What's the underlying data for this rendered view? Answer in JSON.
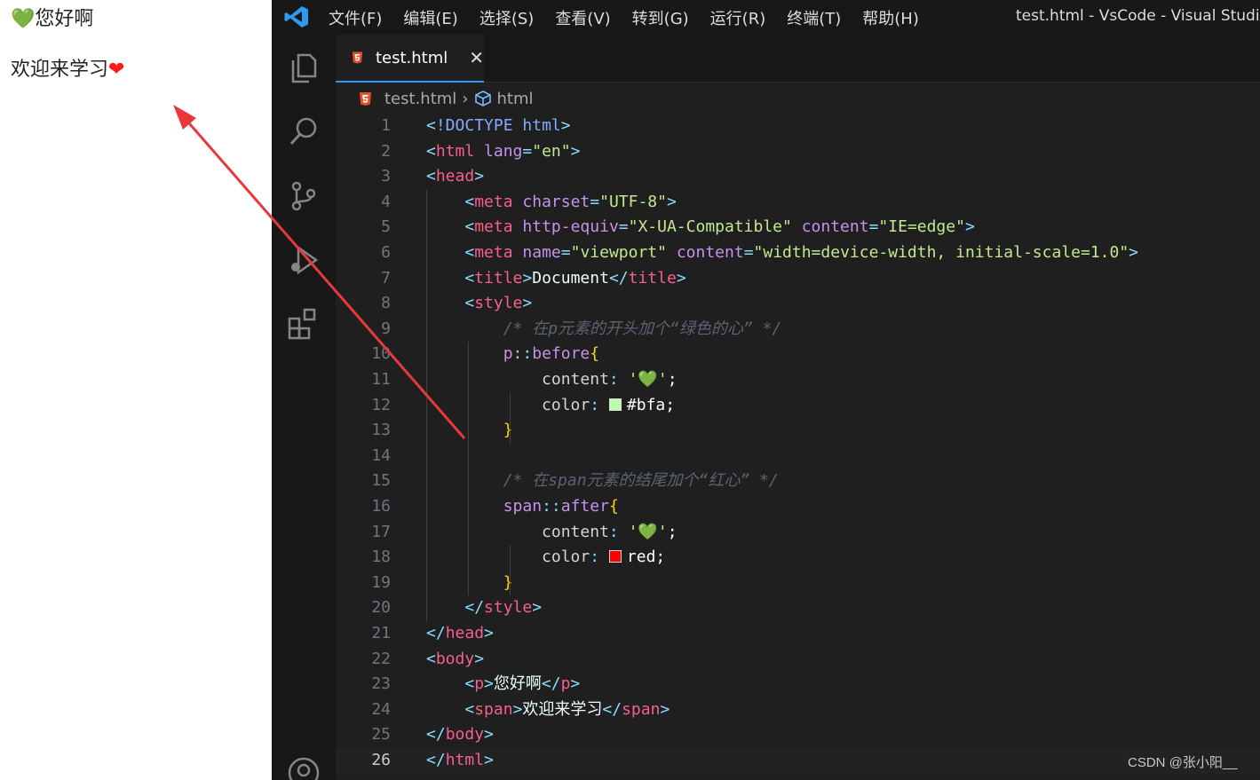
{
  "browser": {
    "p_before": "💚",
    "p_text": "您好啊",
    "span_text": "欢迎来学习",
    "span_after": "❤"
  },
  "titlebar": {
    "menus": [
      "文件(F)",
      "编辑(E)",
      "选择(S)",
      "查看(V)",
      "转到(G)",
      "运行(R)",
      "终端(T)",
      "帮助(H)"
    ],
    "window_title": "test.html - VsCode - Visual Studio"
  },
  "activity_icons": [
    "explorer-icon",
    "search-icon",
    "source-control-icon",
    "run-debug-icon",
    "extensions-icon",
    "account-icon"
  ],
  "tab": {
    "label": "test.html",
    "close": "✕"
  },
  "breadcrumb": {
    "file": "test.html",
    "separator": "›",
    "symbol": "html"
  },
  "editor": {
    "current_line": 26,
    "lines": [
      "<!DOCTYPE html>",
      "<html lang=\"en\">",
      "<head>",
      "    <meta charset=\"UTF-8\">",
      "    <meta http-equiv=\"X-UA-Compatible\" content=\"IE=edge\">",
      "    <meta name=\"viewport\" content=\"width=device-width, initial-scale=1.0\">",
      "    <title>Document</title>",
      "    <style>",
      "        /* 在p元素的开头加个“绿色的心” */",
      "        p::before{",
      "            content: '💚';",
      "            color: #bfa;",
      "        }",
      "",
      "        /* 在span元素的结尾加个“红心” */",
      "        span::after{",
      "            content: '💚';",
      "            color: red;",
      "        }",
      "    </style>",
      "</head>",
      "<body>",
      "    <p>您好啊</p>",
      "    <span>欢迎来学习</span>",
      "</body>",
      "</html>"
    ]
  },
  "colors": {
    "swatch_green": "#bbffaa",
    "swatch_red": "#ff0000",
    "accent": "#3794ff",
    "arrow": "#e8383d"
  },
  "watermark": "CSDN @张小阳__"
}
